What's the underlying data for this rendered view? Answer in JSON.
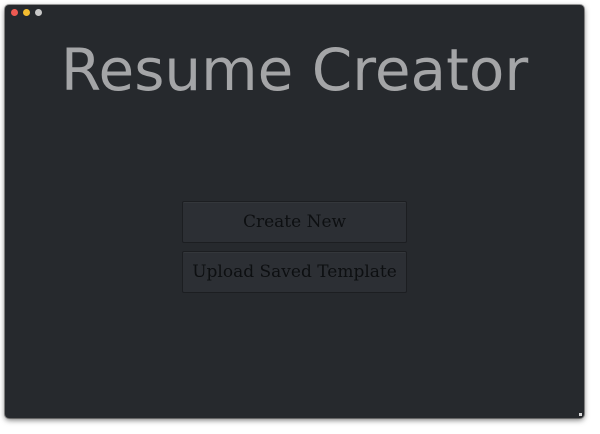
{
  "window": {
    "controls": [
      {
        "name": "close",
        "color": "#ee5a52"
      },
      {
        "name": "minimize",
        "color": "#f4bd30"
      },
      {
        "name": "zoom",
        "color": "#c8c8c8"
      }
    ]
  },
  "app": {
    "title": "Resume Creator"
  },
  "actions": {
    "create_new_label": "Create New",
    "upload_template_label": "Upload Saved Template"
  },
  "colors": {
    "background": "#26292d",
    "title_text": "#a4a5a7",
    "button_bg": "#2c2f34",
    "button_text": "#0d0f11"
  }
}
